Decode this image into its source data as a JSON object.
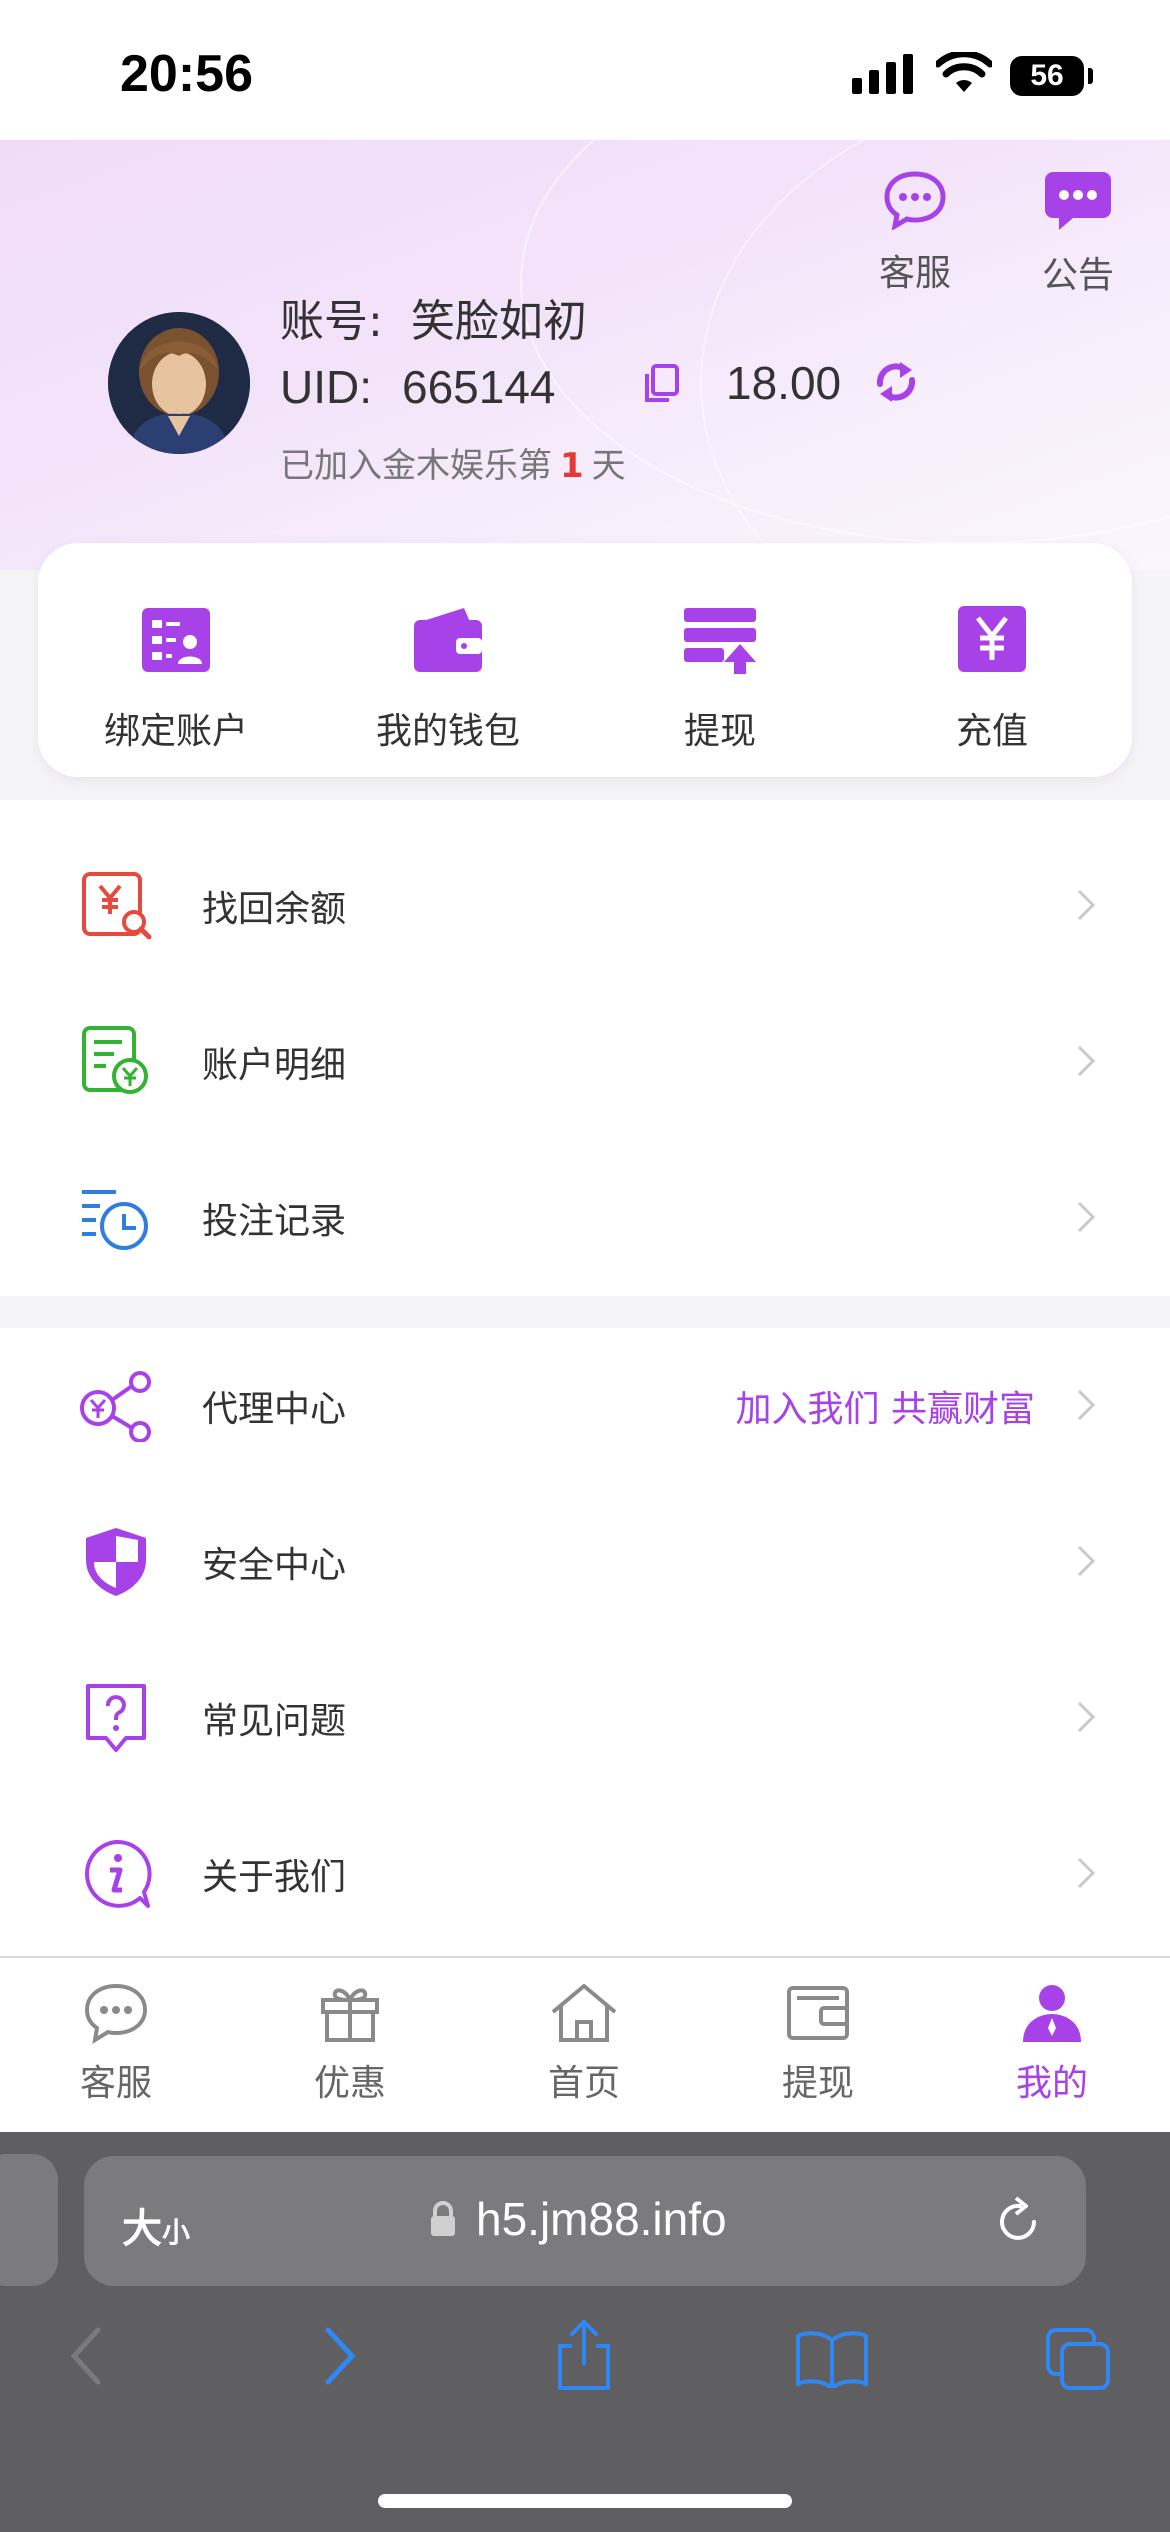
{
  "status_bar": {
    "time": "20:56",
    "battery": "56"
  },
  "header": {
    "service_label": "客服",
    "notice_label": "公告",
    "account_label": "账号:",
    "account_value": "笑脸如初",
    "uid_label": "UID:",
    "uid_value": "665144",
    "balance": "18.00",
    "joined_prefix": "已加入金木娱乐第",
    "joined_days": "1",
    "joined_suffix": "天"
  },
  "quick_actions": [
    {
      "label": "绑定账户",
      "icon": "id-card-icon"
    },
    {
      "label": "我的钱包",
      "icon": "wallet-icon"
    },
    {
      "label": "提现",
      "icon": "withdraw-icon"
    },
    {
      "label": "充值",
      "icon": "recharge-icon"
    }
  ],
  "menu": {
    "section1": [
      {
        "label": "找回余额",
        "icon": "recover-balance-icon"
      },
      {
        "label": "账户明细",
        "icon": "account-details-icon"
      },
      {
        "label": "投注记录",
        "icon": "bet-history-icon"
      }
    ],
    "section2": [
      {
        "label": "代理中心",
        "icon": "agent-share-icon",
        "extra": "加入我们 共赢财富"
      },
      {
        "label": "安全中心",
        "icon": "shield-icon"
      },
      {
        "label": "常见问题",
        "icon": "question-icon"
      },
      {
        "label": "关于我们",
        "icon": "info-icon"
      }
    ]
  },
  "tabbar": [
    {
      "label": "客服",
      "icon": "chat-icon"
    },
    {
      "label": "优惠",
      "icon": "gift-icon"
    },
    {
      "label": "首页",
      "icon": "home-icon"
    },
    {
      "label": "提现",
      "icon": "wallet-icon"
    },
    {
      "label": "我的",
      "icon": "user-icon",
      "active": true
    }
  ],
  "safari": {
    "text_size_label": "大",
    "text_size_small": "小",
    "url": "h5.jm88.info"
  },
  "colors": {
    "accent": "#a742e8",
    "red": "#e53935",
    "green": "#34b233"
  }
}
